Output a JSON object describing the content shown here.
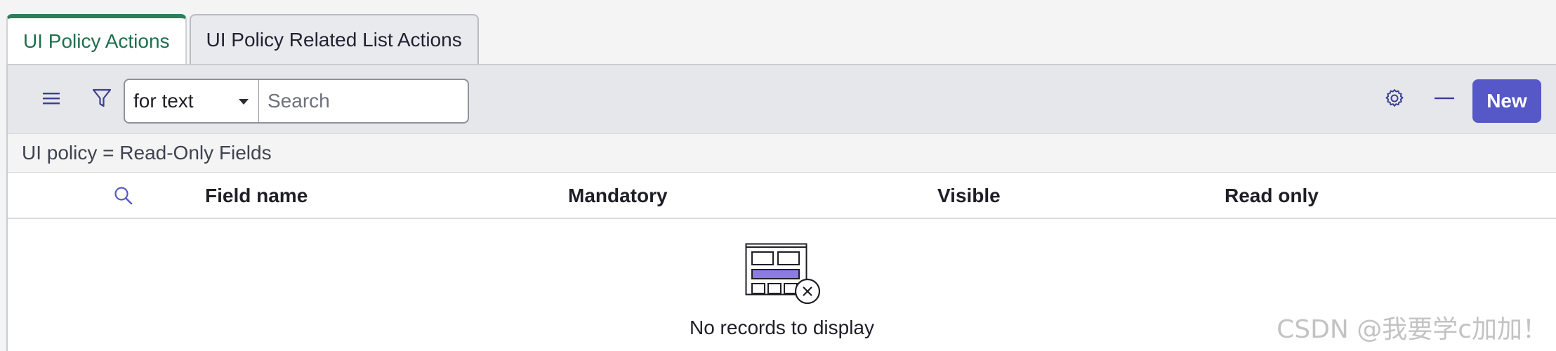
{
  "tabs": [
    {
      "label": "UI Policy Actions",
      "active": true
    },
    {
      "label": "UI Policy Related List Actions",
      "active": false
    }
  ],
  "toolbar": {
    "menu_icon": "hamburger-icon",
    "filter_icon": "funnel-icon",
    "search_field": "for text",
    "search_placeholder": "Search",
    "settings_icon": "gear-icon",
    "collapse_icon": "minus-icon",
    "new_label": "New"
  },
  "breadcrumb": "UI policy = Read-Only Fields",
  "columns": [
    "Field name",
    "Mandatory",
    "Visible",
    "Read only"
  ],
  "empty_state": {
    "message": "No records to display",
    "icon": "empty-list-icon"
  },
  "watermark": "CSDN @我要学c加加！",
  "colors": {
    "accent": "#5558c6",
    "active_tab": "#2e7d5b"
  }
}
